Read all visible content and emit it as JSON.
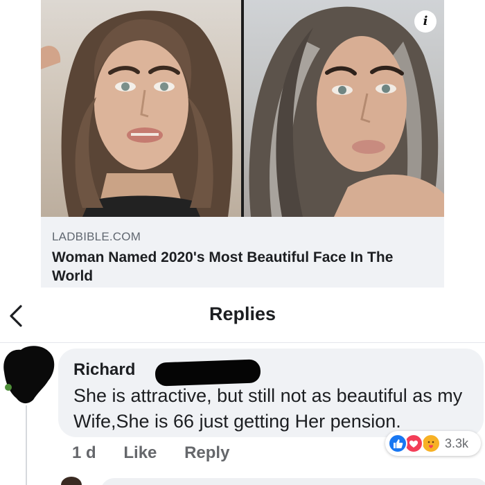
{
  "link_preview": {
    "domain": "LADBIBLE.COM",
    "title": "Woman Named 2020's Most Beautiful Face In The World",
    "info_icon": "info-icon",
    "info_glyph": "i"
  },
  "header": {
    "title": "Replies",
    "back_icon": "chevron-left-icon"
  },
  "comment": {
    "author": "Richard",
    "text": "She is attractive, but still not as beautiful as my Wife,She is 66 just getting Her pension.",
    "timestamp": "1 d",
    "like_label": "Like",
    "reply_label": "Reply",
    "reactions": {
      "icons": [
        "like-icon",
        "love-icon",
        "care-icon"
      ],
      "count": "3.3k"
    }
  },
  "colors": {
    "card_background": "#f0f2f5",
    "text_primary": "#1c1e21",
    "text_secondary": "#65676b",
    "like_blue": "#1877f2",
    "love_red": "#f33e58",
    "care_yellow": "#f7b125"
  }
}
